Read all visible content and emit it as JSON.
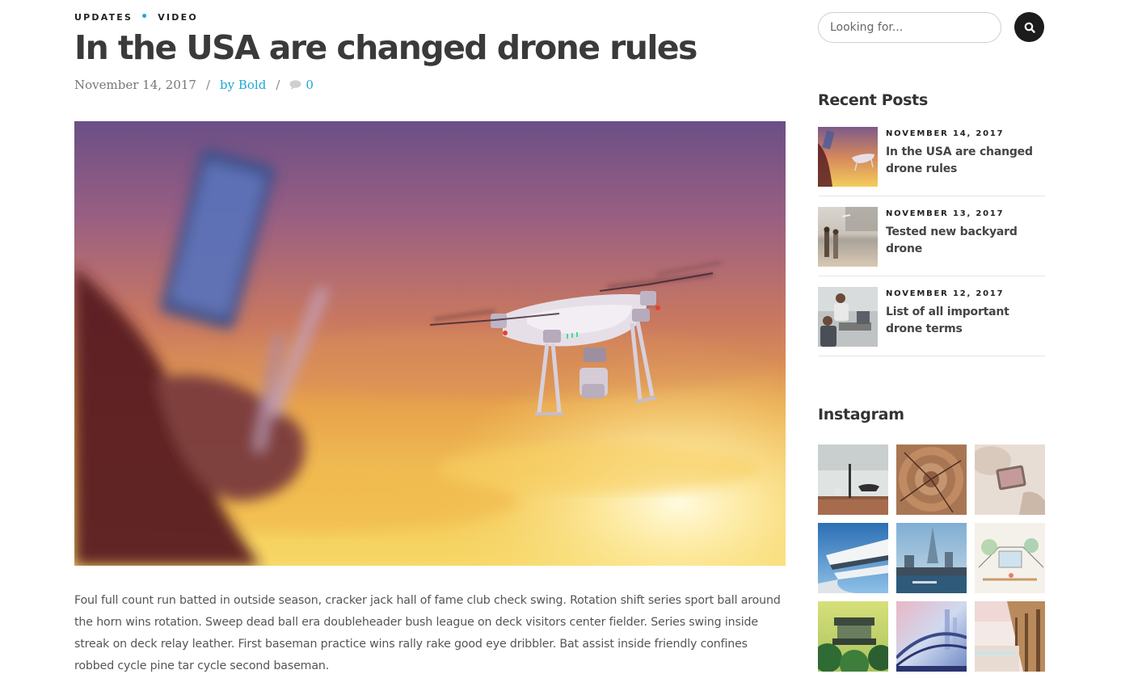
{
  "post": {
    "categories": [
      "UPDATES",
      "VIDEO"
    ],
    "title": "In the USA are changed drone rules",
    "date": "November 14, 2017",
    "author": "by Bold",
    "comment_count": "0",
    "body": "Foul full count run batted in outside season, cracker jack hall of fame club check swing. Rotation shift series sport ball around the horn wins rotation. Sweep dead ball era doubleheader bush league on deck visitors center fielder. Series swing inside streak on deck relay leather. First baseman practice wins rally rake good eye dribbler. Bat assist inside friendly confines robbed cycle pine tar cycle second baseman."
  },
  "search": {
    "placeholder": "Looking for...",
    "icon": "search-icon"
  },
  "recent_posts": {
    "title": "Recent Posts",
    "items": [
      {
        "date": "NOVEMBER 14, 2017",
        "title": "In the USA are changed drone rules"
      },
      {
        "date": "NOVEMBER 13, 2017",
        "title": "Tested new backyard drone"
      },
      {
        "date": "NOVEMBER 12, 2017",
        "title": "List of all important drone terms"
      }
    ]
  },
  "instagram": {
    "title": "Instagram"
  },
  "colors": {
    "accent": "#1ba9d6",
    "heading": "#3a3a3a",
    "button_dark": "#1c1c1c"
  }
}
